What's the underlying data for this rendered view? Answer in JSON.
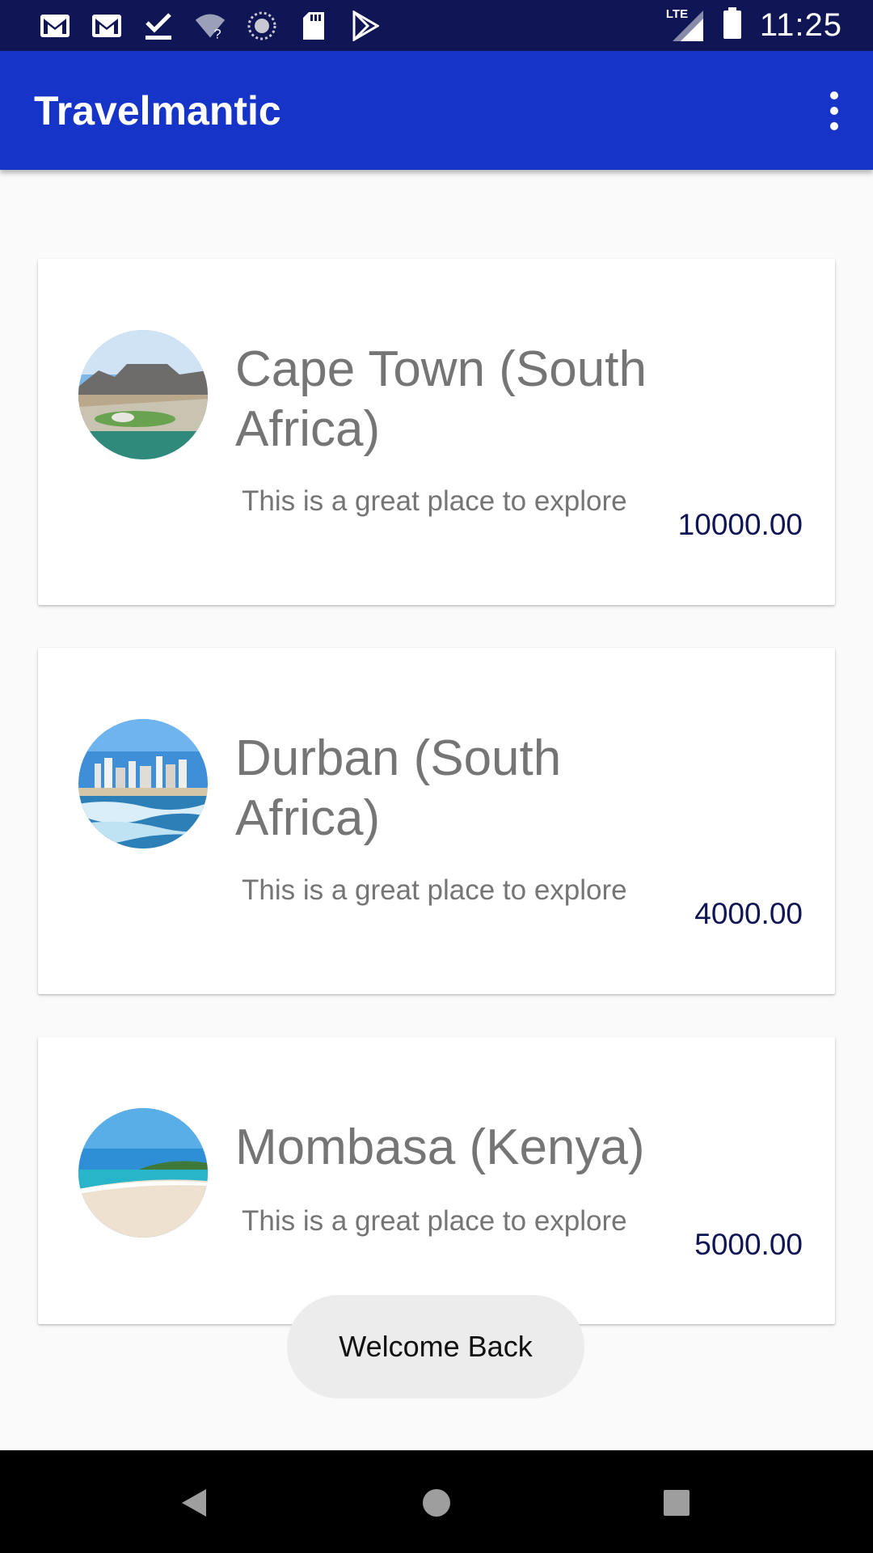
{
  "status_bar": {
    "time": "11:25",
    "network": "LTE",
    "icons": [
      "gmail-icon",
      "gmail-icon",
      "download-done-icon",
      "wifi-unknown-icon",
      "sync-icon",
      "sd-card-icon",
      "play-store-icon"
    ]
  },
  "app_bar": {
    "title": "Travelmantic",
    "overflow_icon": "more-vert-icon"
  },
  "deals": [
    {
      "title": "Cape Town (South Africa)",
      "description": "This is a great place to explore",
      "price": "10000.00"
    },
    {
      "title": "Durban (South Africa)",
      "description": "This is a great place to explore",
      "price": "4000.00"
    },
    {
      "title": "Mombasa (Kenya)",
      "description": "This is a great place to explore",
      "price": "5000.00"
    }
  ],
  "toast": "Welcome Back",
  "nav_bar": {
    "back_icon": "back-icon",
    "home_icon": "home-icon",
    "recents_icon": "recents-icon"
  },
  "colors": {
    "app_bar": "#1734c8",
    "status_bar": "#101555",
    "price": "#101555",
    "text_secondary": "#757575"
  }
}
